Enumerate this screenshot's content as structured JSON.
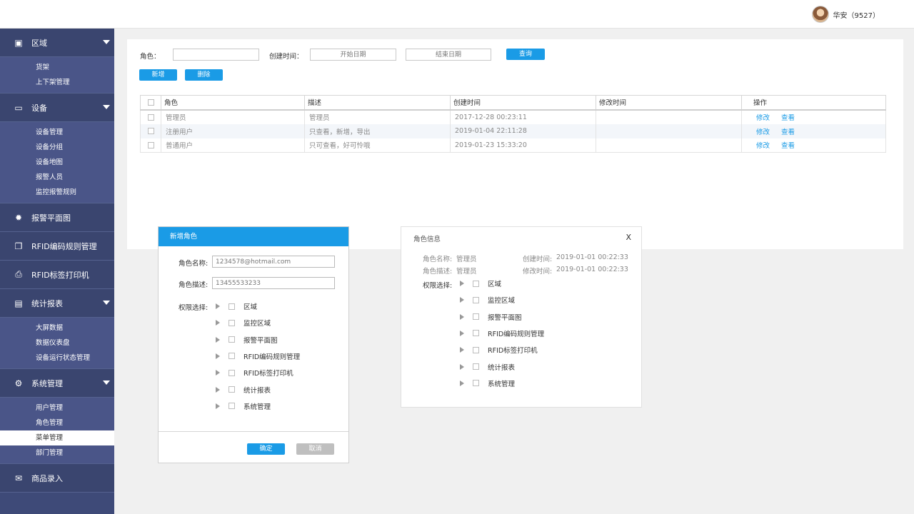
{
  "user": {
    "name": "华安（9527）"
  },
  "sidebar": {
    "groups": [
      {
        "label": "区域",
        "icon": "map-icon",
        "expandable": true,
        "items": [
          "货架",
          "上下架管理"
        ]
      },
      {
        "label": "设备",
        "icon": "monitor-icon",
        "expandable": true,
        "items": [
          "设备管理",
          "设备分组",
          "设备地图",
          "报警人员",
          "监控报警规则"
        ]
      },
      {
        "label": "报警平面图",
        "icon": "alarm-icon",
        "expandable": false,
        "items": []
      },
      {
        "label": "RFID编码规则管理",
        "icon": "rfid-code-icon",
        "expandable": false,
        "items": []
      },
      {
        "label": "RFID标签打印机",
        "icon": "printer-icon",
        "expandable": false,
        "items": []
      },
      {
        "label": "统计报表",
        "icon": "report-icon",
        "expandable": true,
        "items": [
          "大屏数据",
          "数据仪表盘",
          "设备运行状态管理"
        ]
      },
      {
        "label": "系统管理",
        "icon": "gear-icon",
        "expandable": true,
        "items": [
          "用户管理",
          "角色管理",
          "菜单管理",
          "部门管理"
        ]
      },
      {
        "label": "商品录入",
        "icon": "mail-icon",
        "expandable": false,
        "items": []
      }
    ],
    "active_item": "菜单管理"
  },
  "filter": {
    "role_label": "角色：",
    "created_label": "创建时间：",
    "start_placeholder": "开始日期",
    "end_placeholder": "结束日期",
    "query_button": "查询",
    "add_button": "新增",
    "delete_button": "删除"
  },
  "table": {
    "headers": [
      "角色",
      "描述",
      "创建时间",
      "修改时间",
      "操作"
    ],
    "rows": [
      {
        "role": "管理员",
        "desc": "管理员",
        "created": "2017-12-28 00:23:11",
        "modified": ""
      },
      {
        "role": "注册用户",
        "desc": "只查看，新增，导出",
        "created": "2019-01-04 22:11:28",
        "modified": ""
      },
      {
        "role": "普通用户",
        "desc": "只可查看，好可怜哦",
        "created": "2019-01-23 15:33:20",
        "modified": ""
      }
    ],
    "edit_link": "修改",
    "view_link": "查看"
  },
  "add_dialog": {
    "title": "新增角色",
    "name_label": "角色名称:",
    "name_value": "1234578@hotmail.com",
    "desc_label": "角色描述:",
    "desc_value": "13455533233",
    "perm_label": "权限选择:",
    "perms": [
      "区域",
      "监控区域",
      "报警平面图",
      "RFID编码规则管理",
      "RFID标签打印机",
      "统计报表",
      "系统管理"
    ],
    "ok_button": "确定",
    "cancel_button": "取消"
  },
  "info_panel": {
    "title": "角色信息",
    "close": "X",
    "name_label": "角色名称:",
    "name_value": "管理员",
    "desc_label": "角色描述:",
    "desc_value": "管理员",
    "created_label": "创建时间:",
    "created_value": "2019-01-01 00:22:33",
    "modified_label": "修改时间:",
    "modified_value": "2019-01-01 00:22:33",
    "perm_label": "权限选择:",
    "perms": [
      "区域",
      "监控区域",
      "报警平面图",
      "RFID编码规则管理",
      "RFID标签打印机",
      "统计报表",
      "系统管理"
    ]
  },
  "colors": {
    "sidebar": "#3e4a78",
    "accent": "#1a9be6",
    "link": "#1a9be6"
  }
}
